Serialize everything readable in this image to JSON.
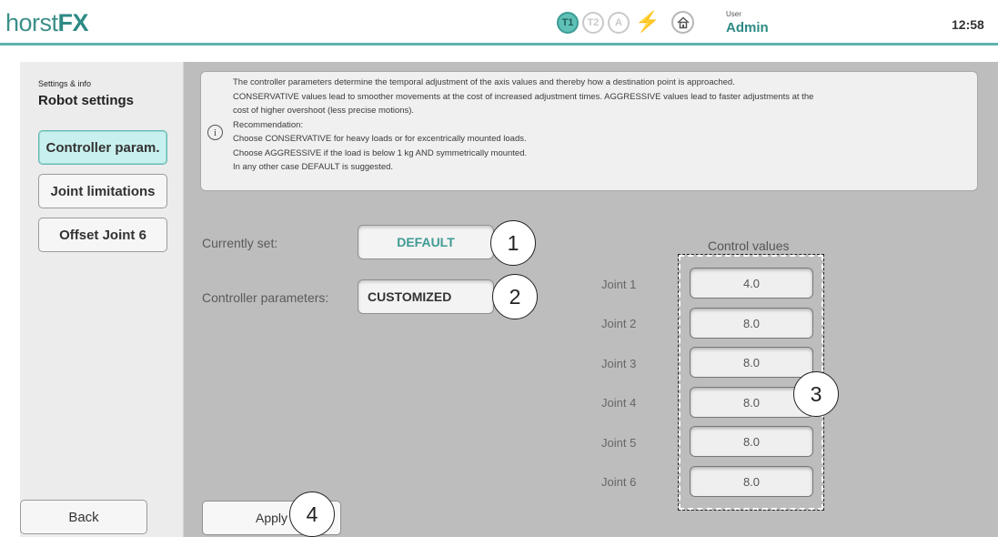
{
  "header": {
    "logo_light": "horst",
    "logo_bold": "FX",
    "modes": [
      "T1",
      "T2",
      "A"
    ],
    "active_mode": "T1",
    "user_caption": "User",
    "user_name": "Admin",
    "time": "12:58"
  },
  "sidebar": {
    "caption": "Settings & info",
    "title": "Robot settings",
    "items": [
      {
        "label": "Controller param.",
        "active": true
      },
      {
        "label": "Joint limitations",
        "active": false
      },
      {
        "label": "Offset Joint 6",
        "active": false
      }
    ],
    "back_label": "Back"
  },
  "info": {
    "icon": "info-icon",
    "lines": [
      "The controller parameters determine the temporal adjustment of the axis values and thereby how a destination point is approached.",
      "CONSERVATIVE values lead to smoother movements at the cost of increased adjustment times. AGGRESSIVE values lead to faster adjustments at the",
      "cost of higher overshoot (less precise motions).",
      "Recommendation:",
      "Choose CONSERVATIVE for heavy loads or for excentrically mounted loads.",
      "Choose AGGRESSIVE if the load is below 1 kg AND symmetrically mounted.",
      "In any other case DEFAULT is suggested."
    ]
  },
  "form": {
    "currently_set_label": "Currently set:",
    "currently_set_value": "DEFAULT",
    "controller_params_label": "Controller parameters:",
    "controller_params_value": "CUSTOMIZED",
    "apply_label": "Apply"
  },
  "control_values": {
    "title": "Control values",
    "joints": [
      {
        "label": "Joint 1",
        "value": "4.0"
      },
      {
        "label": "Joint 2",
        "value": "8.0"
      },
      {
        "label": "Joint 3",
        "value": "8.0"
      },
      {
        "label": "Joint 4",
        "value": "8.0"
      },
      {
        "label": "Joint 5",
        "value": "8.0"
      },
      {
        "label": "Joint 6",
        "value": "8.0"
      }
    ]
  },
  "callouts": [
    "1",
    "2",
    "3",
    "4"
  ],
  "colors": {
    "accent": "#2e8a84",
    "active_tab_bg": "#c8f0ee",
    "panel_bg": "#bdbdbd"
  }
}
